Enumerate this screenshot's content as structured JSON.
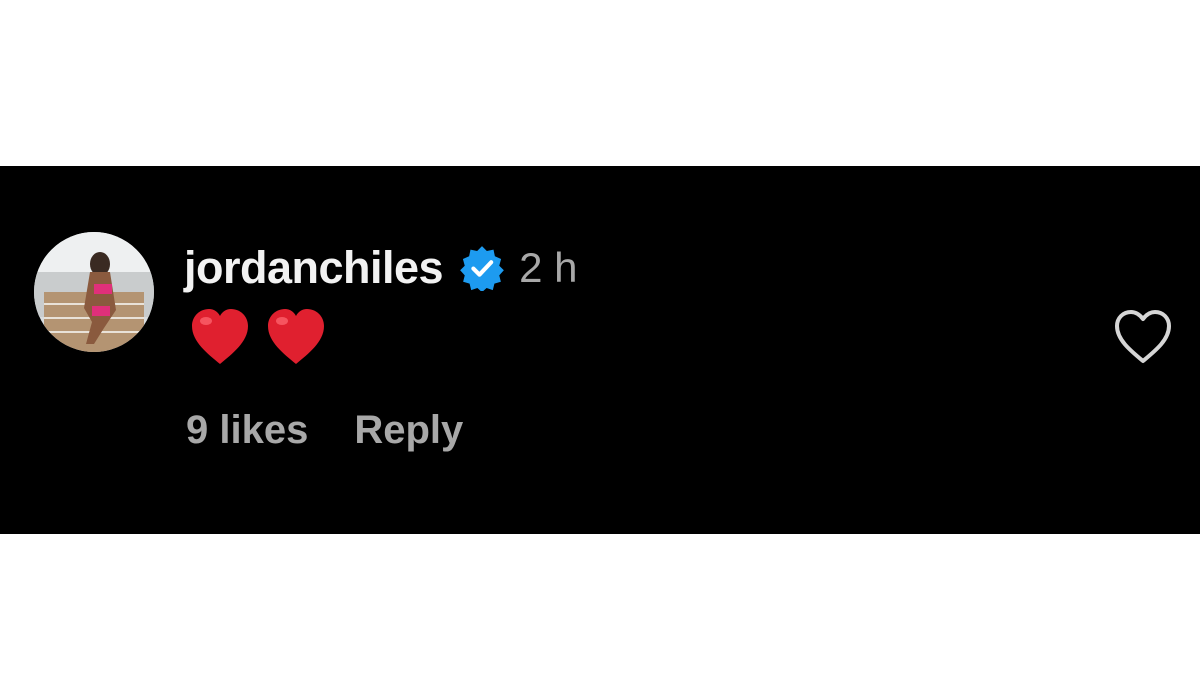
{
  "comment": {
    "username": "jordanchiles",
    "verified": true,
    "timestamp": "2 h",
    "text_emojis": [
      "red-heart",
      "red-heart"
    ],
    "likes_label": "9 likes",
    "reply_label": "Reply",
    "like_icon": "heart-outline-icon"
  },
  "colors": {
    "panel_background": "#000000",
    "username": "#f2f2f2",
    "secondary_text": "#a8a8a8",
    "verified_badge": "#1d9bf0",
    "heart_emoji": "#e0202f"
  }
}
